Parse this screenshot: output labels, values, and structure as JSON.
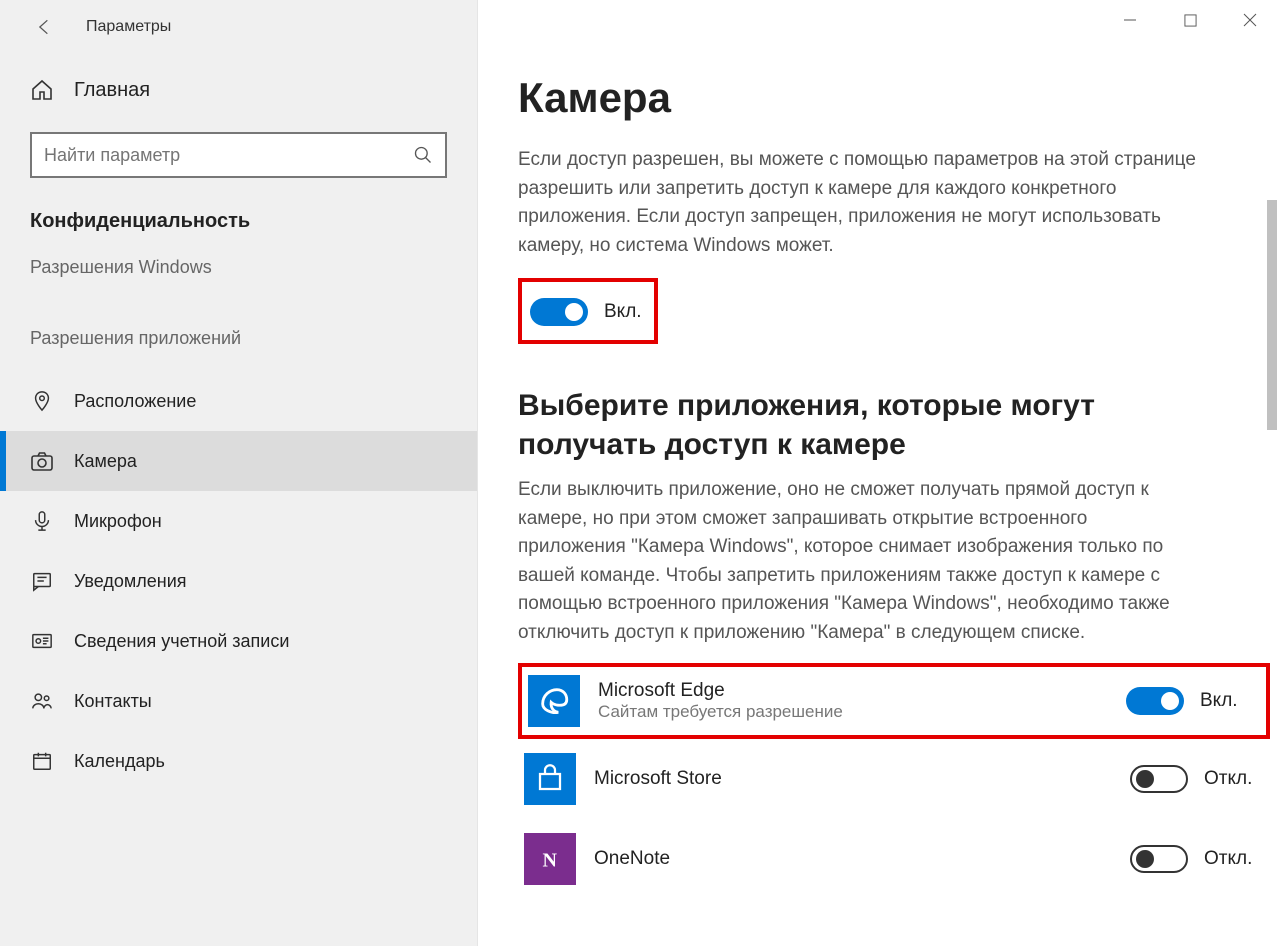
{
  "window": {
    "title": "Параметры"
  },
  "sidebar": {
    "home": "Главная",
    "search_placeholder": "Найти параметр",
    "section": "Конфиденциальность",
    "group_windows": "Разрешения Windows",
    "group_apps": "Разрешения приложений",
    "items": {
      "location": "Расположение",
      "camera": "Камера",
      "microphone": "Микрофон",
      "notifications": "Уведомления",
      "account": "Сведения учетной записи",
      "contacts": "Контакты",
      "calendar": "Календарь"
    }
  },
  "main": {
    "title": "Камера",
    "intro": "Если доступ разрешен, вы можете с помощью параметров на этой странице разрешить или запретить доступ к камере для каждого конкретного приложения. Если доступ запрещен, приложения не могут использовать камеру, но система Windows может.",
    "master_toggle_label": "Вкл.",
    "choose_heading": "Выберите приложения, которые могут получать доступ к камере",
    "choose_body": "Если выключить приложение, оно не сможет получать прямой доступ к камере, но при этом сможет запрашивать открытие встроенного приложения \"Камера Windows\", которое снимает изображения только по вашей команде. Чтобы запретить приложениям также доступ к камере с помощью встроенного приложения \"Камера Windows\", необходимо также отключить доступ к приложению \"Камера\" в следующем списке.",
    "apps": {
      "edge": {
        "name": "Microsoft Edge",
        "sub": "Сайтам требуется разрешение",
        "state": "Вкл."
      },
      "store": {
        "name": "Microsoft Store",
        "state": "Откл."
      },
      "onenote": {
        "name": "OneNote",
        "state": "Откл."
      }
    }
  }
}
